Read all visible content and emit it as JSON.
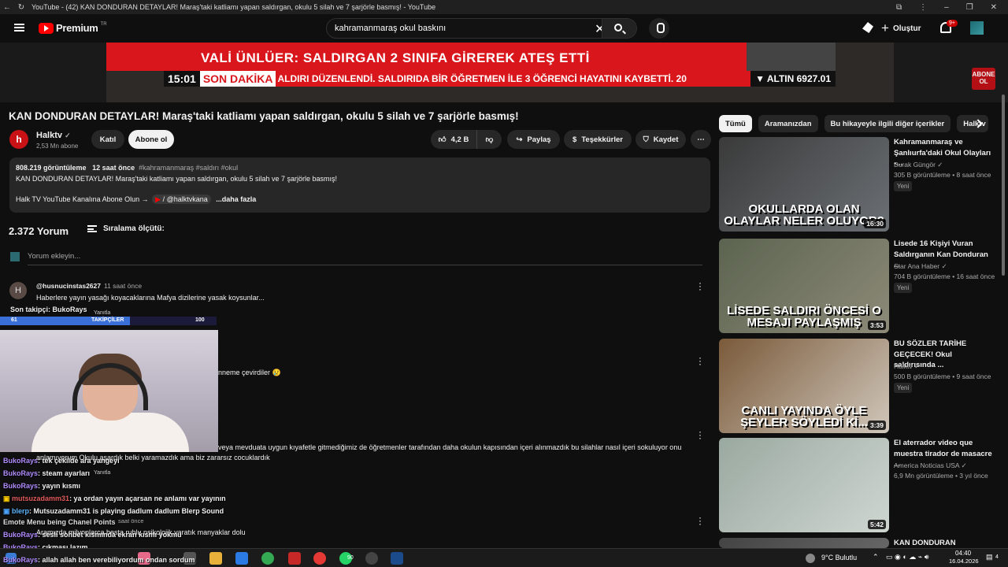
{
  "browser": {
    "tab_title": "YouTube - (42) KAN DONDURAN DETAYLAR! Maraş'taki katliamı yapan saldırgan, okulu 5 silah ve 7 şarjörle basmış! - YouTube"
  },
  "header": {
    "logo_text": "Premium",
    "logo_region": "TR",
    "search_value": "kahramanmaraş okul baskını",
    "create_label": "Oluştur",
    "notif_count": "9+"
  },
  "video": {
    "headline": "VALİ ÜNLÜER: SALDIRGAN 2 SINIFA GİREREK ATEŞ ETTİ",
    "clock": "15:01",
    "breaking": "SON DAKİKA",
    "ticker": "ALDIRI DÜZENLENDİ. SALDIRIDA BİR ÖĞRETMEN İLE 3 ÖĞRENCİ HAYATINI KAYBETTİ. 20",
    "gold": "▼ ALTIN 6927.01",
    "abone_badge": "ABONE OL"
  },
  "main": {
    "title": "KAN DONDURAN DETAYLAR! Maraş'taki katliamı yapan saldırgan, okulu 5 silah ve 7 şarjörle basmış!",
    "channel_name": "Halktv",
    "channel_initial": "h",
    "subscribers": "2,53 Mn abone",
    "join_label": "Katıl",
    "subscribe_label": "Abone ol",
    "likes": "4,2 B",
    "share_label": "Paylaş",
    "thanks_label": "Teşekkürler",
    "save_label": "Kaydet",
    "description": {
      "views": "808.219 görüntüleme",
      "time": "12 saat önce",
      "tags": "#kahramanmaraş #saldırı #okul",
      "line2": "KAN DONDURAN DETAYLAR! Maraş'taki katliamı yapan saldırgan, okulu 5 silah ve 7 şarjörle basmış!",
      "line3": "Halk TV YouTube Kanalına Abone Olun →",
      "handle": "/ @halktvkana",
      "more": "...daha fazla"
    },
    "comment_count": "2.372 Yorum",
    "sort_label": "Sıralama ölçütü:",
    "add_comment": "Yorum ekleyin...",
    "comments": [
      {
        "avatar": "H",
        "user": "@husnucinstas2627",
        "time": "11 saat önce",
        "text": "Haberlere yayın yasağı koyacaklarına Mafya dizilerine yasak koysunlar...",
        "reply": "Yanıtla"
      },
      {
        "text": "nneme çevirdiler 😢"
      },
      {
        "text": "veya mevduata uygun kıyafetle gitmediğimiz de öğretmenler tarafından daha okulun kapısından içeri alınmazdık bu silahlar nasıl içeri sokuluyor onu",
        "text2": "anlamıyorum Okulu aşardık belki yaramazdık ama biz zararsız cocuklardık",
        "reply": "Yanıtla"
      },
      {
        "time": "saat önce",
        "text": "Aramızda milyonlarca basta ruhlu psikolojik yaratık manyaklar dolu"
      }
    ]
  },
  "overlay": {
    "last_follower": "Son takipçi: BukoRays",
    "follow_left": "61",
    "follow_label": "TAKİPÇİLER",
    "follow_right": "100",
    "chat": [
      {
        "name": "BukoRays",
        "msg": ": tek çekilde ara yangeyi"
      },
      {
        "name": "BukoRays",
        "msg": ": steam ayarları"
      },
      {
        "name": "BukoRays",
        "msg": ": yayın kısmı"
      },
      {
        "name": "mutsuzadamm31",
        "msg": ": ya ordan yayın açarsan ne anlamı var yayının"
      },
      {
        "name": "blerp",
        "msg": ": Mutsuzadamm31 is playing dadlum dadlum Blerp Sound"
      },
      {
        "name": "Emote Menu",
        "msg": "being Chanel Points"
      },
      {
        "name": "BukoRays",
        "msg": ": sesli sohbet kısmında ekran kısmı yokmu"
      },
      {
        "name": "BukoRays",
        "msg": ": çıkması lazım"
      },
      {
        "name": "BukoRays",
        "msg": ": allah allah ben verebiliyordum ondan sordum"
      }
    ]
  },
  "sidebar": {
    "chips": [
      "Tümü",
      "Aramanızdan",
      "Bu hikayeyle ilgili diğer içerikler",
      "Halktv"
    ],
    "recs": [
      {
        "title": "Kahramanmaraş ve Şanlıurfa'daki Okul Olayları -...",
        "channel": "Burak Güngör",
        "meta": "305 B görüntüleme • 8 saat önce",
        "badge": "Yeni",
        "duration": "16:30",
        "overlay": "OKULLARDA OLAN OLAYLAR NELER OLUYOR?",
        "color1": "#3a3a3a",
        "color2": "#6b7075"
      },
      {
        "title": "Lisede 16 Kişiyi Vuran Saldırganın Kan Donduran ...",
        "channel": "Star Ana Haber",
        "meta": "704 B görüntüleme • 16 saat önce",
        "badge": "Yeni",
        "duration": "3:53",
        "overlay": "LİSEDE SALDIRI ÖNCESİ O MESAJI PAYLAŞMIŞ",
        "color1": "#5b6450",
        "color2": "#8d8a78"
      },
      {
        "title": "BU SÖZLER TARİHE GEÇECEK! Okul saldırısında ...",
        "channel": "Halktv",
        "meta": "500 B görüntüleme • 9 saat önce",
        "badge": "Yeni",
        "duration": "3:39",
        "overlay": "CANLI YAYINDA ÖYLE ŞEYLER SÖYLEDİ Kİ...",
        "color1": "#7a5a3a",
        "color2": "#d0c7bb"
      },
      {
        "title": "El aterrador video que muestra tirador de masacre ...",
        "channel": "America Noticias USA",
        "meta": "6,9 Mn görüntüleme • 3 yıl önce",
        "badge": "",
        "duration": "5:42",
        "overlay": "",
        "color1": "#9aa9a0",
        "color2": "#cfd6d2"
      },
      {
        "title": "KAN DONDURAN",
        "channel": "",
        "meta": "",
        "badge": "",
        "duration": "",
        "overlay": "",
        "color1": "#444",
        "color2": "#666"
      }
    ]
  },
  "taskbar": {
    "weather": "9°C Bulutlu",
    "time": "04:40",
    "date": "16.04.2026",
    "notif": "4",
    "whatsapp_count": "90"
  }
}
